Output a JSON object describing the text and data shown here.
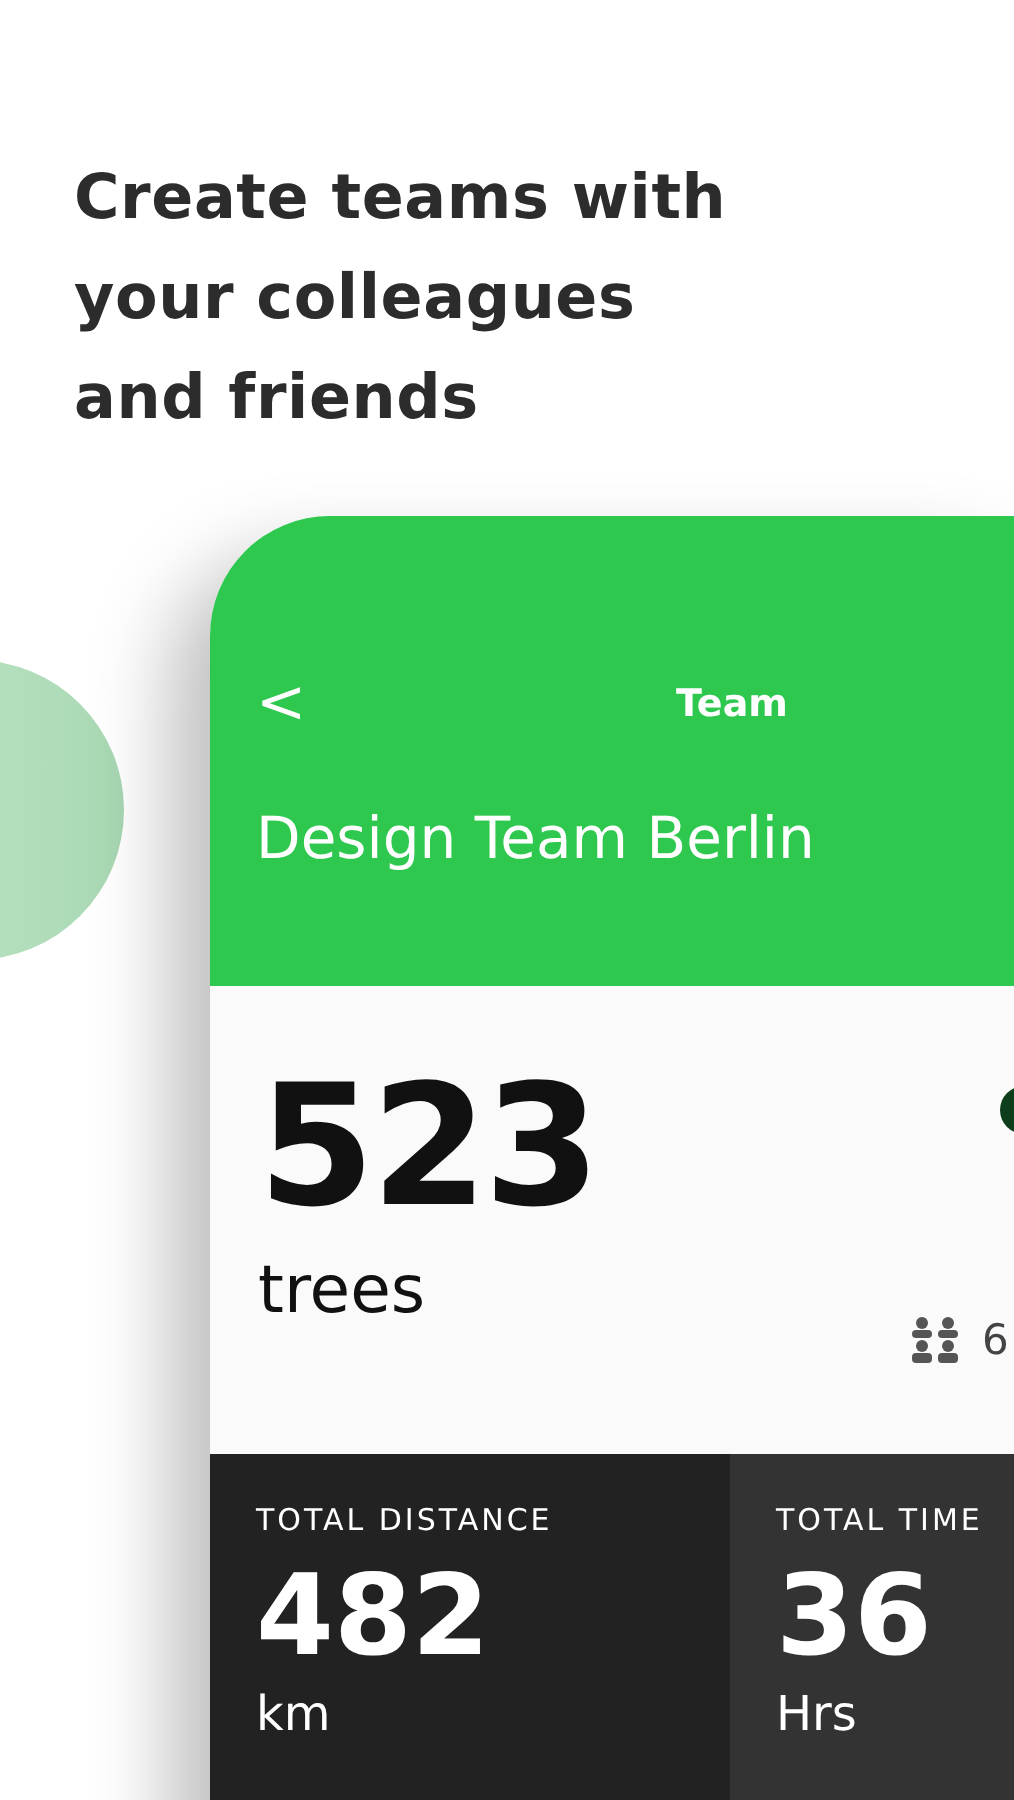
{
  "headline": [
    "Create teams with",
    "your colleagues",
    "and friends"
  ],
  "header": {
    "back": "<",
    "title": "Team",
    "team_name": "Design Team Berlin"
  },
  "summary": {
    "count": "523",
    "unit": "trees",
    "members": "6"
  },
  "stats": [
    {
      "label": "TOTAL DISTANCE",
      "value": "482",
      "unit": "km"
    },
    {
      "label": "TOTAL TIME",
      "value": "36",
      "unit": "Hrs"
    }
  ]
}
